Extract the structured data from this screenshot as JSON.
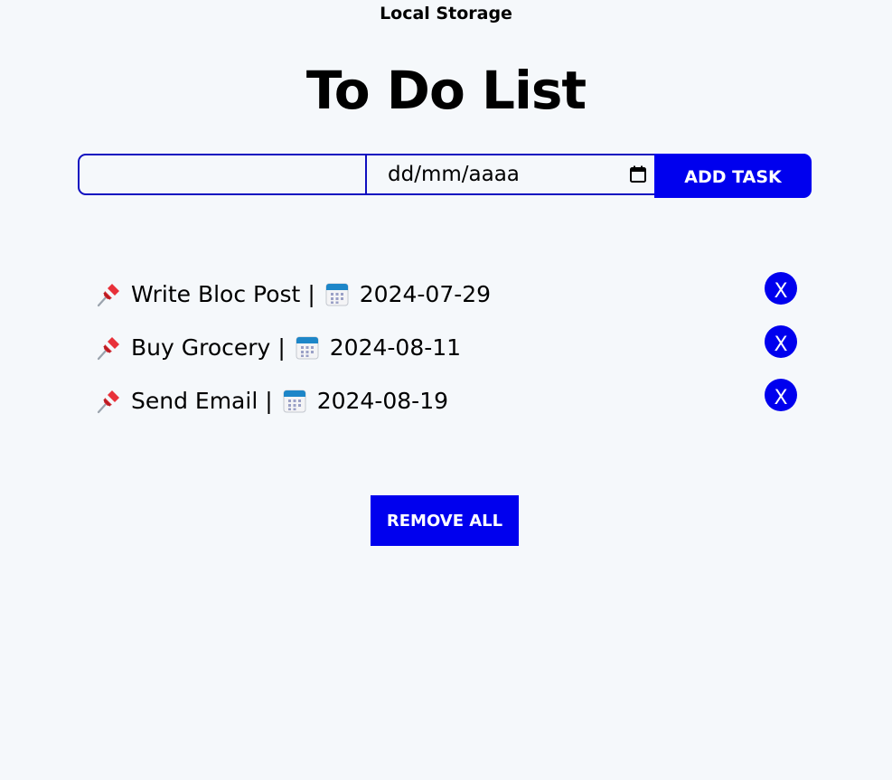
{
  "header": {
    "top_label": "Local Storage",
    "title": "To Do List"
  },
  "form": {
    "task_placeholder": "",
    "task_value": "",
    "date_placeholder": "dd/mm/aaaa",
    "add_label": "ADD TASK"
  },
  "tasks": [
    {
      "name": "Write Bloc Post",
      "separator": "|",
      "date": "2024-07-29",
      "delete_label": "X",
      "icon": "pushpin-icon",
      "date_icon": "calendar-icon"
    },
    {
      "name": "Buy Grocery",
      "separator": "|",
      "date": "2024-08-11",
      "delete_label": "X",
      "icon": "pushpin-icon",
      "date_icon": "calendar-icon"
    },
    {
      "name": "Send Email",
      "separator": "|",
      "date": "2024-08-19",
      "delete_label": "X",
      "icon": "pushpin-icon",
      "date_icon": "calendar-icon"
    }
  ],
  "remove_all_label": "REMOVE ALL",
  "colors": {
    "accent": "#0000ee",
    "border": "#1010c0",
    "background": "#f5f8fb"
  }
}
